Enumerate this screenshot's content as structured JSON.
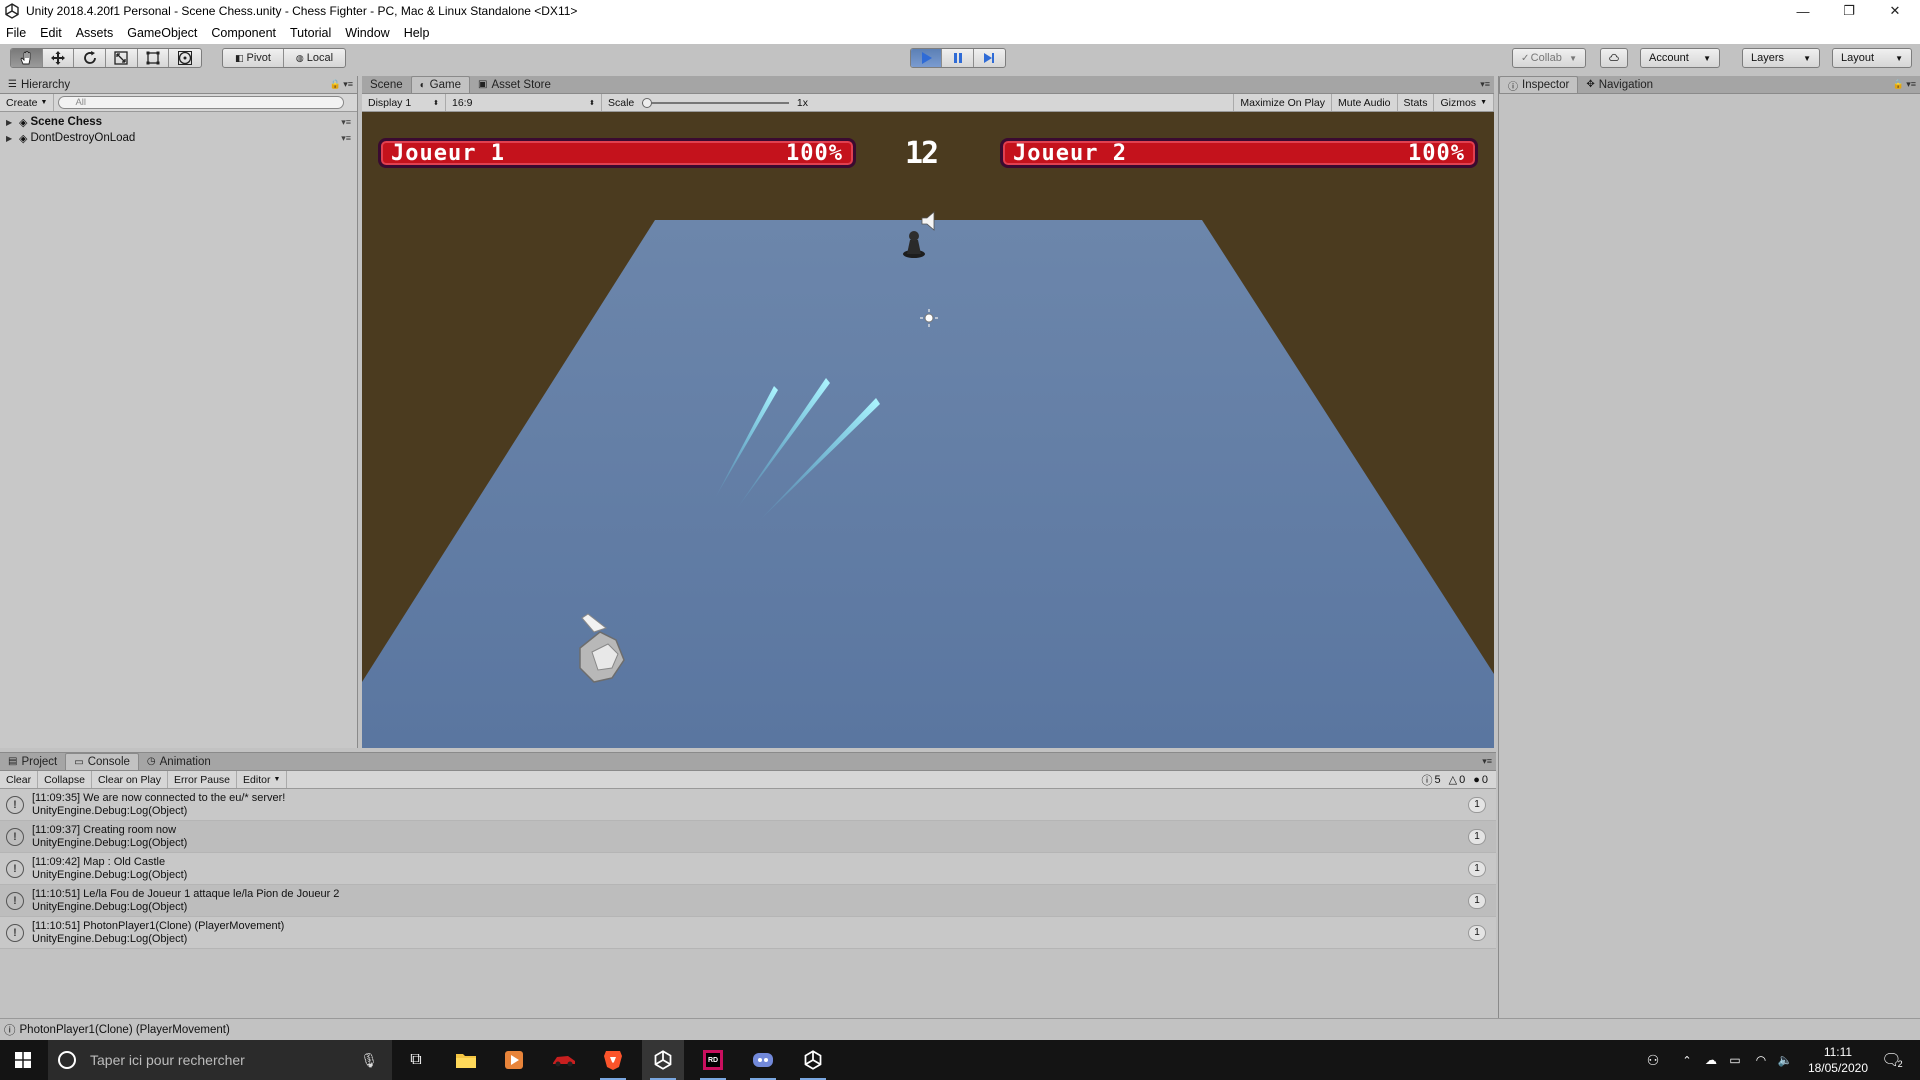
{
  "window": {
    "title": "Unity 2018.4.20f1 Personal - Scene Chess.unity - Chess Fighter - PC, Mac & Linux Standalone <DX11>",
    "controls": {
      "minimize": "—",
      "restore": "❐",
      "close": "✕"
    }
  },
  "menubar": {
    "items": [
      "File",
      "Edit",
      "Assets",
      "GameObject",
      "Component",
      "Tutorial",
      "Window",
      "Help"
    ]
  },
  "toolbar": {
    "tools": [
      "hand-tool",
      "move-tool",
      "rotate-tool",
      "scale-tool",
      "rect-tool",
      "transform-tool"
    ],
    "pivot_label": "Pivot",
    "local_label": "Local",
    "collab_label": "Collab",
    "account_label": "Account",
    "layers_label": "Layers",
    "layout_label": "Layout"
  },
  "hierarchy": {
    "tab_label": "Hierarchy",
    "create_label": "Create",
    "search_placeholder": "All",
    "items": [
      {
        "label": "Scene Chess",
        "bold": true
      },
      {
        "label": "DontDestroyOnLoad",
        "bold": false
      }
    ]
  },
  "center_tabs": [
    "Scene",
    "Game",
    "Asset Store"
  ],
  "game_toolbar": {
    "display": "Display 1",
    "aspect": "16:9",
    "scale_label": "Scale",
    "scale_value": "1x",
    "maximize_label": "Maximize On Play",
    "mute_label": "Mute Audio",
    "stats_label": "Stats",
    "gizmos_label": "Gizmos"
  },
  "game": {
    "player1_name": "Joueur 1",
    "player1_health": "100%",
    "player2_name": "Joueur 2",
    "player2_health": "100%",
    "timer": "12"
  },
  "inspector": {
    "tabs": [
      "Inspector",
      "Navigation"
    ]
  },
  "console": {
    "tabs": [
      "Project",
      "Console",
      "Animation"
    ],
    "buttons": [
      "Clear",
      "Collapse",
      "Clear on Play",
      "Error Pause",
      "Editor"
    ],
    "counts": {
      "logs": "5",
      "warnings": "0",
      "errors": "0"
    },
    "entries": [
      {
        "line1": "[11:09:35] We are now connected to the eu/* server!",
        "line2": "UnityEngine.Debug:Log(Object)",
        "count": "1"
      },
      {
        "line1": "[11:09:37] Creating room now",
        "line2": "UnityEngine.Debug:Log(Object)",
        "count": "1"
      },
      {
        "line1": "[11:09:42] Map : Old Castle",
        "line2": "UnityEngine.Debug:Log(Object)",
        "count": "1"
      },
      {
        "line1": "[11:10:51] Le/la Fou de Joueur 1 attaque le/la Pion de Joueur 2",
        "line2": "UnityEngine.Debug:Log(Object)",
        "count": "1"
      },
      {
        "line1": "[11:10:51] PhotonPlayer1(Clone) (PlayerMovement)",
        "line2": "UnityEngine.Debug:Log(Object)",
        "count": "1"
      }
    ]
  },
  "statusbar": {
    "text": "PhotonPlayer1(Clone) (PlayerMovement)"
  },
  "taskbar": {
    "search_placeholder": "Taper ici pour rechercher",
    "time": "11:11",
    "date": "18/05/2020",
    "notifications": "2"
  },
  "colors": {
    "editor_bg": "#c2c2c2",
    "game_floor": "#5e78a0",
    "game_bg": "#4b3b1f",
    "hud_red": "#c4121c",
    "play_blue": "#5c80b5",
    "taskbar": "#141414"
  }
}
